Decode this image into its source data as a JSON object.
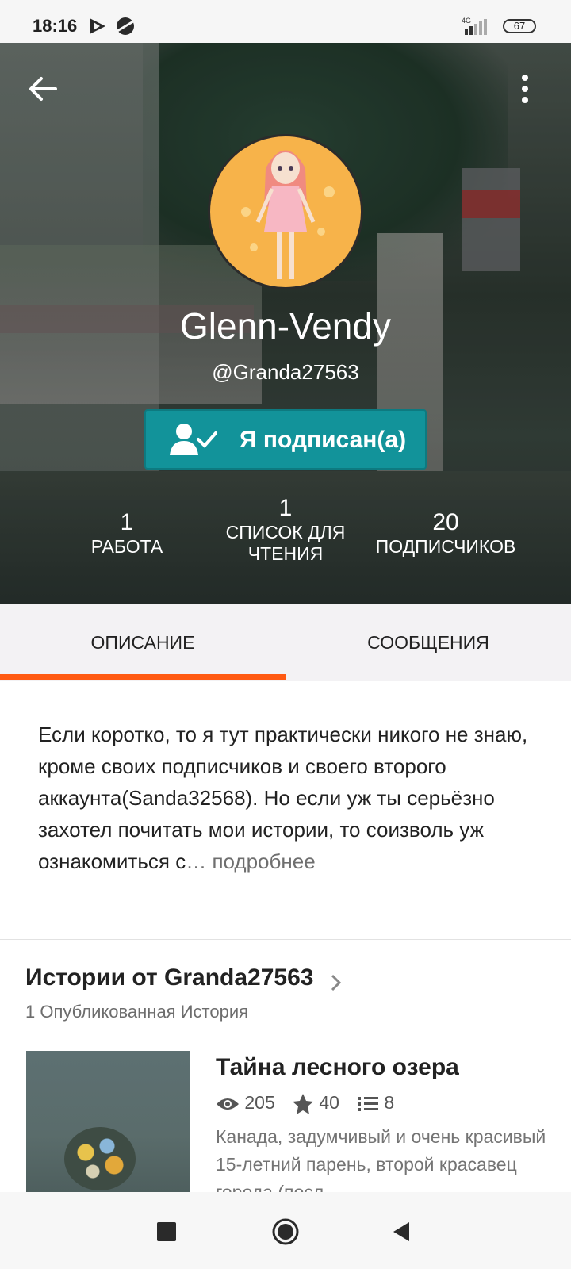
{
  "status_bar": {
    "time": "18:16",
    "network": "4G",
    "battery": "67"
  },
  "header": {
    "back_icon": "arrow-left-icon",
    "more_icon": "more-vertical-icon",
    "display_name": "Glenn-Vendy",
    "username": "@Granda27563",
    "follow_button": "Я подписан(а)",
    "follow_icon": "user-check-icon",
    "stats": {
      "works": {
        "value": "1",
        "label": "РАБОТА"
      },
      "reading_lists": {
        "value": "1",
        "label_line1": "СПИСОК ДЛЯ",
        "label_line2": "ЧТЕНИЯ"
      },
      "followers": {
        "value": "20",
        "label": "ПОДПИСЧИКОВ"
      }
    }
  },
  "tabs": {
    "description": "ОПИСАНИЕ",
    "messages": "СООБЩЕНИЯ",
    "active": "description",
    "accent": "#ff5a12"
  },
  "about": {
    "text": "Если коротко, то я тут практически никого не знаю, кроме своих подписчиков и своего второго аккаунта(Sanda32568). Но если уж ты серьёзно захотел почитать мои истории, то соизволь уж ознакомиться с",
    "ellipsis": "…",
    "more": "подробнее"
  },
  "stories": {
    "title": "Истории от Granda27563",
    "subtitle": "1 Опубликованная История",
    "items": [
      {
        "title": "Тайна лесного озера",
        "reads": "205",
        "votes": "40",
        "parts": "8",
        "description": "Канада, задумчивый и очень красивый 15-летний парень, второй красавец города (посл"
      }
    ]
  },
  "nav": {
    "recents_icon": "square-icon",
    "home_icon": "circle-home-icon",
    "back_icon": "triangle-back-icon"
  },
  "colors": {
    "follow_button": "#12939a",
    "tab_indicator": "#ff5a12"
  }
}
